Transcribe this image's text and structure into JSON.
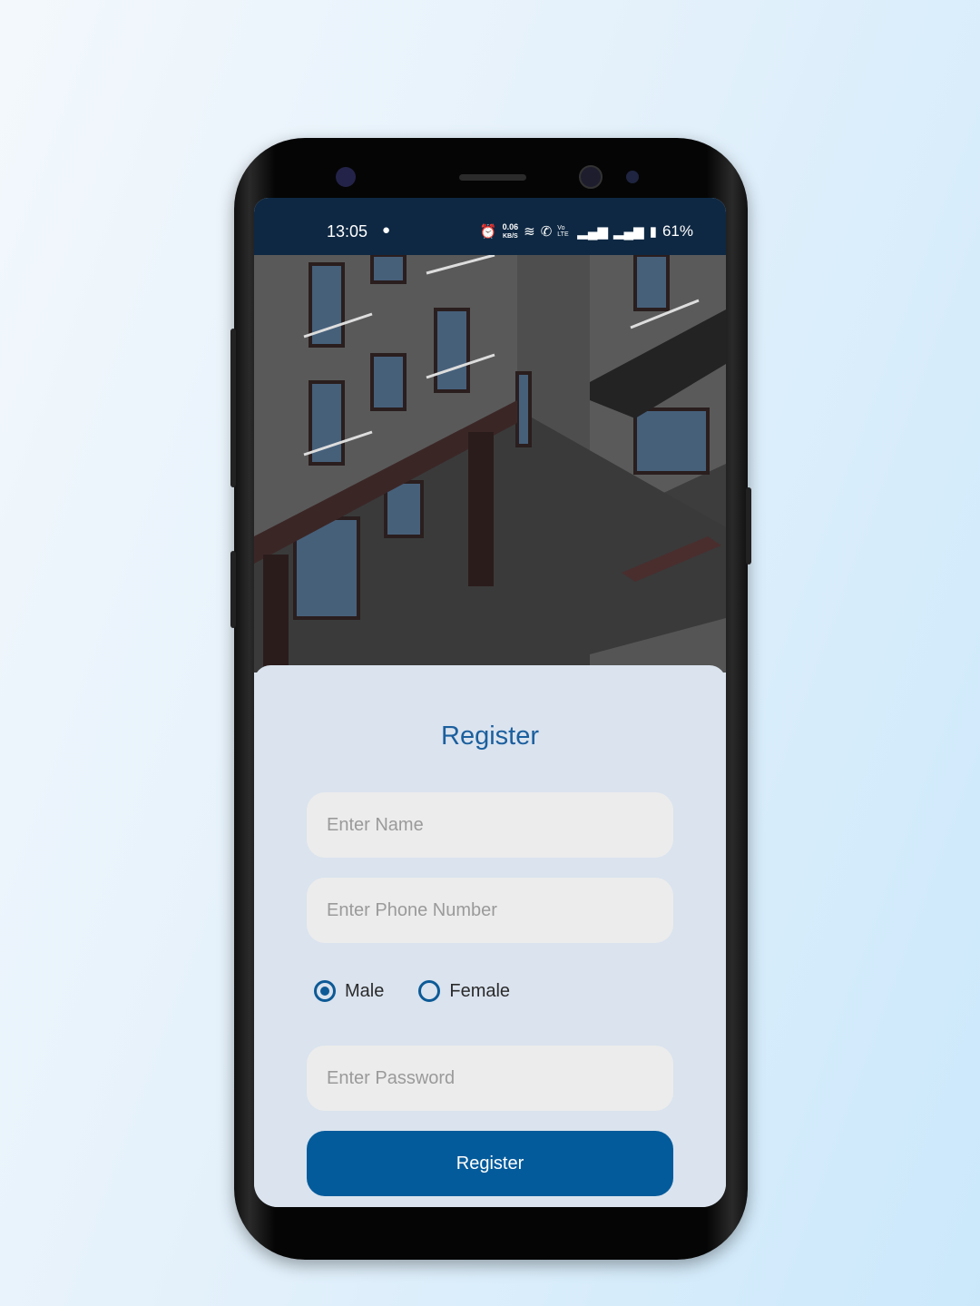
{
  "status_bar": {
    "time": "13:05",
    "net_speed": "0.06",
    "net_unit": "KB/S",
    "volte": "Vo LTE",
    "battery": "61%"
  },
  "form": {
    "title": "Register",
    "name_placeholder": "Enter Name",
    "phone_placeholder": "Enter Phone Number",
    "gender_options": [
      {
        "label": "Male",
        "selected": true
      },
      {
        "label": "Female",
        "selected": false
      }
    ],
    "password_placeholder": "Enter Password",
    "submit_label": "Register"
  },
  "colors": {
    "accent": "#045b9b",
    "title": "#1b5f9e",
    "status_bar": "#0e2843",
    "card": "#dae3ee"
  }
}
